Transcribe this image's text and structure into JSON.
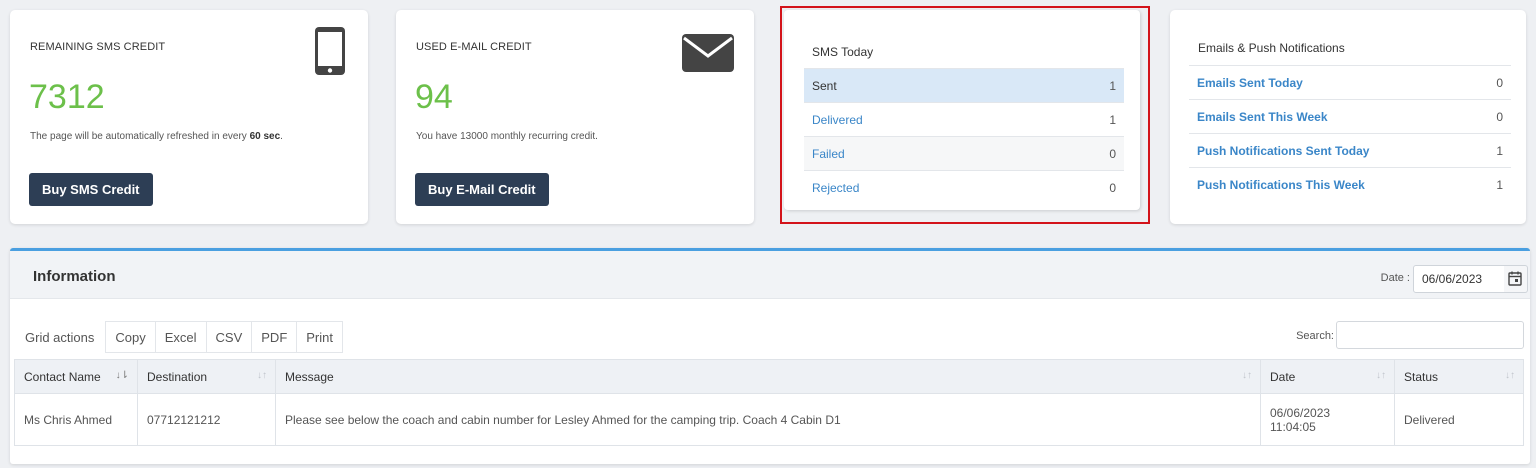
{
  "sms_card": {
    "label": "REMAINING SMS CREDIT",
    "value": "7312",
    "note_prefix": "The page will be automatically refreshed in every ",
    "note_bold": "60 sec",
    "note_suffix": ".",
    "button": "Buy SMS Credit",
    "icon": "smartphone-icon"
  },
  "email_card": {
    "label": "USED E-MAIL CREDIT",
    "value": "94",
    "note": "You have 13000 monthly recurring credit.",
    "button": "Buy E-Mail Credit",
    "icon": "envelope-icon"
  },
  "sms_today": {
    "title": "SMS Today",
    "rows": [
      {
        "label": "Sent",
        "value": "1"
      },
      {
        "label": "Delivered",
        "value": "1"
      },
      {
        "label": "Failed",
        "value": "0"
      },
      {
        "label": "Rejected",
        "value": "0"
      }
    ]
  },
  "push": {
    "title": "Emails & Push Notifications",
    "rows": [
      {
        "label": "Emails Sent Today",
        "value": "0"
      },
      {
        "label": "Emails Sent This Week",
        "value": "0"
      },
      {
        "label": "Push Notifications Sent Today",
        "value": "1"
      },
      {
        "label": "Push Notifications This Week",
        "value": "1"
      }
    ]
  },
  "info": {
    "title": "Information",
    "date_label": "Date :",
    "date_value": "06/06/2023",
    "grid_actions_label": "Grid actions",
    "grid_buttons": [
      "Copy",
      "Excel",
      "CSV",
      "PDF",
      "Print"
    ],
    "search_label": "Search:",
    "columns": [
      "Contact Name",
      "Destination",
      "Message",
      "Date",
      "Status"
    ],
    "rows": [
      {
        "contact": "Ms Chris Ahmed",
        "destination": "07712121212",
        "message": "Please see below the coach and cabin number for Lesley Ahmed for the camping trip. Coach 4 Cabin D1",
        "date": "06/06/2023",
        "time": "11:04:05",
        "status": "Delivered"
      }
    ]
  },
  "colors": {
    "credit_green": "#6cc04a",
    "button_dark": "#2d3e55",
    "link_blue": "#3a86c8",
    "highlight_red": "#d3131a",
    "panel_accent": "#4a9fe0"
  }
}
